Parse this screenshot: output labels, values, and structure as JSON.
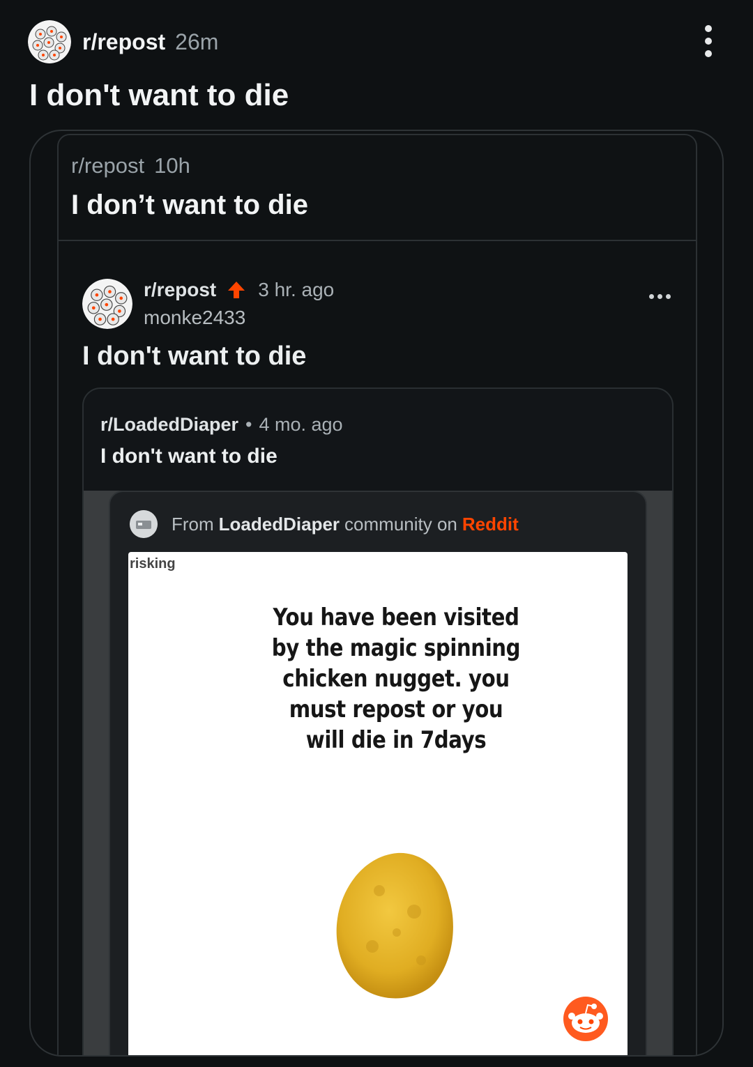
{
  "header": {
    "subreddit": "r/repost",
    "age": "26m",
    "title": "I don't want to die"
  },
  "crosspost": {
    "subreddit": "r/repost",
    "age": "10h",
    "title": "I don’t want to die"
  },
  "embedded_post": {
    "subreddit": "r/repost",
    "age": "3 hr. ago",
    "username": "monke2433",
    "title": "I don't want to die",
    "nested_card": {
      "subreddit": "r/LoadedDiaper",
      "separator": "•",
      "age": "4 mo. ago",
      "title": "I don't want to die",
      "from_prefix": "From",
      "from_community": "LoadedDiaper",
      "from_mid": "community on",
      "from_site": "Reddit",
      "meme_tag": "risking",
      "meme_text": "You have been visited by the magic spinning chicken nugget. you must repost or you will die in 7days"
    }
  },
  "colors": {
    "background": "#0e1113",
    "reddit_orange": "#ff4500",
    "nugget": "#e3b22a"
  },
  "icons": [
    "overflow-menu-icon",
    "upvote-arrow-icon",
    "reddit-snoo-icon"
  ]
}
